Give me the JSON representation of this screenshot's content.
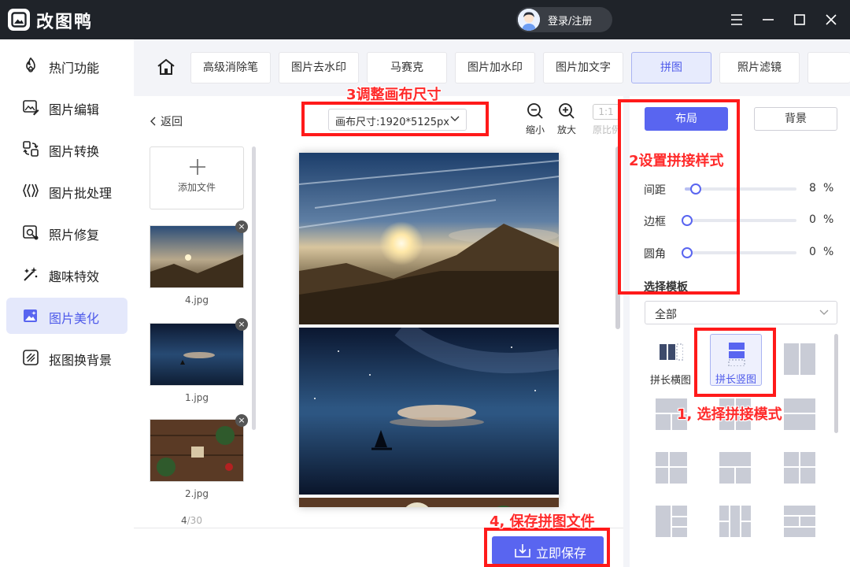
{
  "app": {
    "title": "改图鸭",
    "login_label": "登录/注册"
  },
  "sidebar": {
    "items": [
      {
        "label": "热门功能",
        "icon": "flame-icon"
      },
      {
        "label": "图片编辑",
        "icon": "image-edit-icon"
      },
      {
        "label": "图片转换",
        "icon": "convert-icon"
      },
      {
        "label": "图片批处理",
        "icon": "batch-icon"
      },
      {
        "label": "照片修复",
        "icon": "photo-repair-icon"
      },
      {
        "label": "趣味特效",
        "icon": "magic-wand-icon"
      },
      {
        "label": "图片美化",
        "icon": "beautify-icon",
        "active": true
      },
      {
        "label": "抠图换背景",
        "icon": "cutout-icon"
      }
    ]
  },
  "tool_tabs": [
    "高级消除笔",
    "图片去水印",
    "马赛克",
    "图片加水印",
    "图片加文字",
    "拼图",
    "照片滤镜"
  ],
  "active_tool": "拼图",
  "work": {
    "back_label": "返回",
    "canvas_size": "画布尺寸:1920*5125px",
    "zoom_out": "缩小",
    "zoom_in": "放大",
    "ratio_value": "1:1",
    "ratio_label": "原比例",
    "add_file": "添加文件",
    "files": [
      "4.jpg",
      "1.jpg",
      "2.jpg"
    ],
    "count_current": "4",
    "count_total": "/30",
    "save_label": "立即保存"
  },
  "right_panel": {
    "tab_layout": "布局",
    "tab_background": "背景",
    "sliders": [
      {
        "label": "间距",
        "value": "8",
        "unit": "%",
        "level": 0.08
      },
      {
        "label": "边框",
        "value": "0",
        "unit": "%",
        "level": 0
      },
      {
        "label": "圆角",
        "value": "0",
        "unit": "%",
        "level": 0
      }
    ],
    "template_section": "选择模板",
    "template_filter": "全部",
    "modes": [
      {
        "label": "拼长横图"
      },
      {
        "label": "拼长竖图",
        "active": true
      }
    ]
  },
  "annotations": {
    "step1": "1, 选择拼接模式",
    "step2": "2设置拼接样式",
    "step3": "3调整画布尺寸",
    "step4": "4, 保存拼图文件"
  },
  "colors": {
    "accent": "#5965f0",
    "titlebar": "#1f2329",
    "annotation": "#ff1a1a"
  }
}
